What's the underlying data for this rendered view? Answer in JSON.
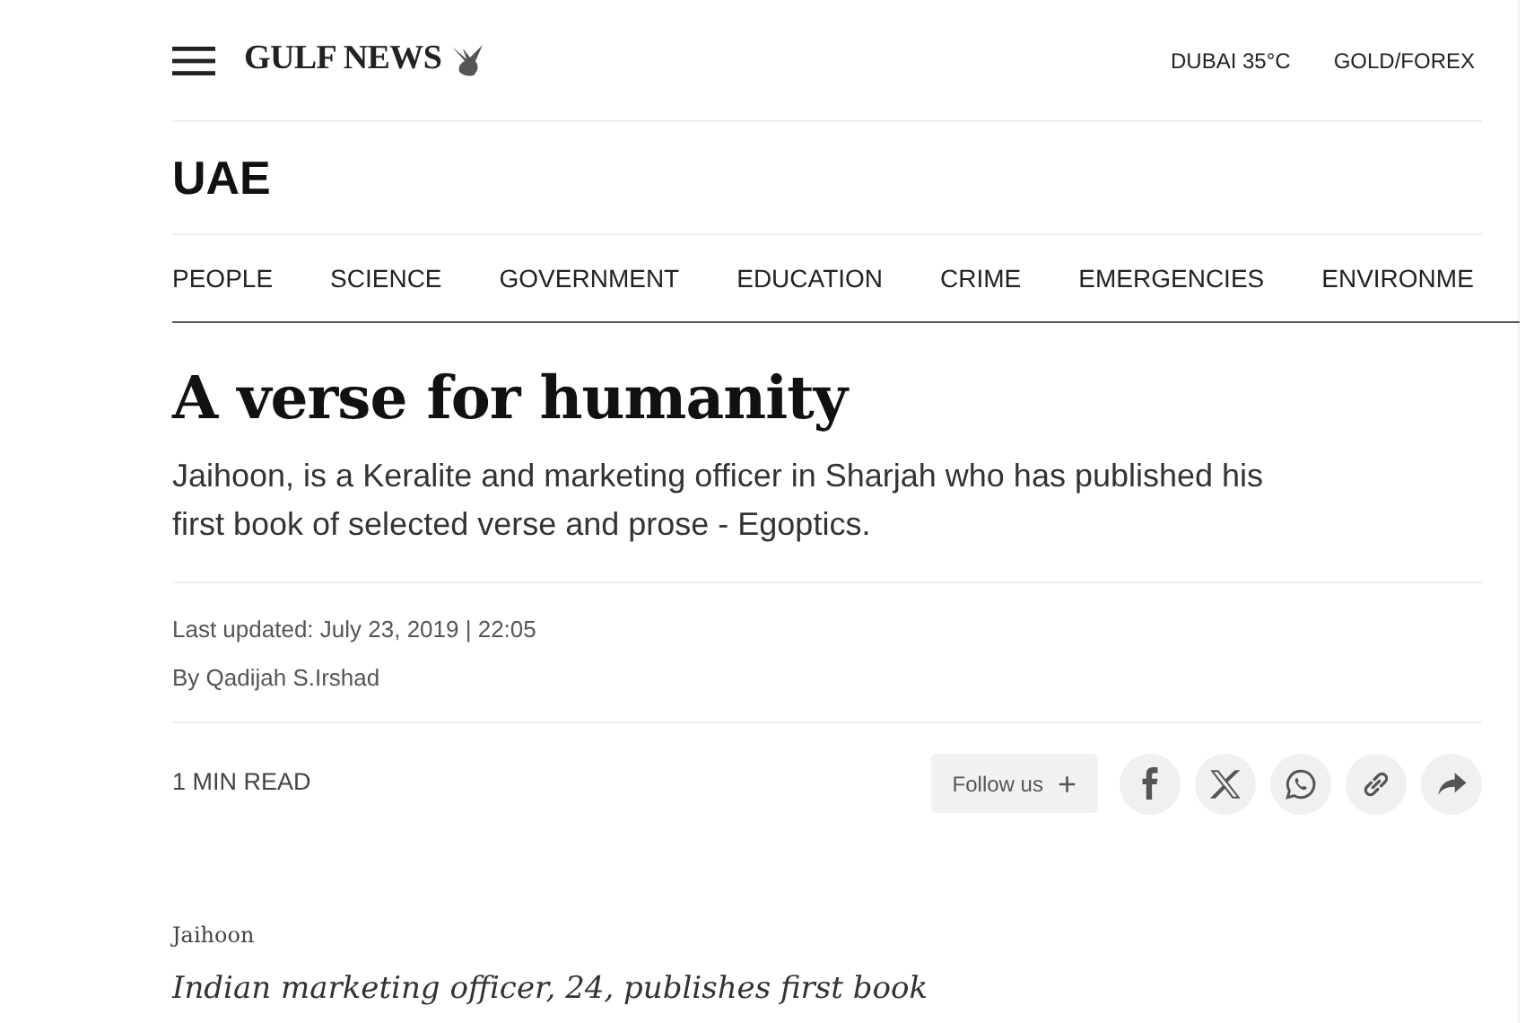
{
  "header": {
    "logo": "GULF NEWS",
    "links": [
      "DUBAI 35°C",
      "GOLD/FOREX"
    ]
  },
  "section": {
    "title": "UAE"
  },
  "nav": [
    "PEOPLE",
    "SCIENCE",
    "GOVERNMENT",
    "EDUCATION",
    "CRIME",
    "EMERGENCIES",
    "ENVIRONME"
  ],
  "article": {
    "title": "A verse for humanity",
    "summary": "Jaihoon, is a Keralite and marketing officer in Sharjah who has published his first book of selected verse and prose - Egoptics.",
    "updated": "Last updated: July 23, 2019 | 22:05",
    "byline": "By Qadijah S.Irshad",
    "read_time": "1 MIN READ",
    "follow": "Follow us",
    "follow_icon": "+",
    "share_buttons": [
      {
        "kind": "facebook"
      },
      {
        "kind": "x"
      },
      {
        "kind": "whatsapp"
      },
      {
        "kind": "link"
      },
      {
        "kind": "share"
      }
    ],
    "image_credit": "Jaihoon",
    "image_caption": "Indian marketing officer, 24, publishes first book"
  }
}
